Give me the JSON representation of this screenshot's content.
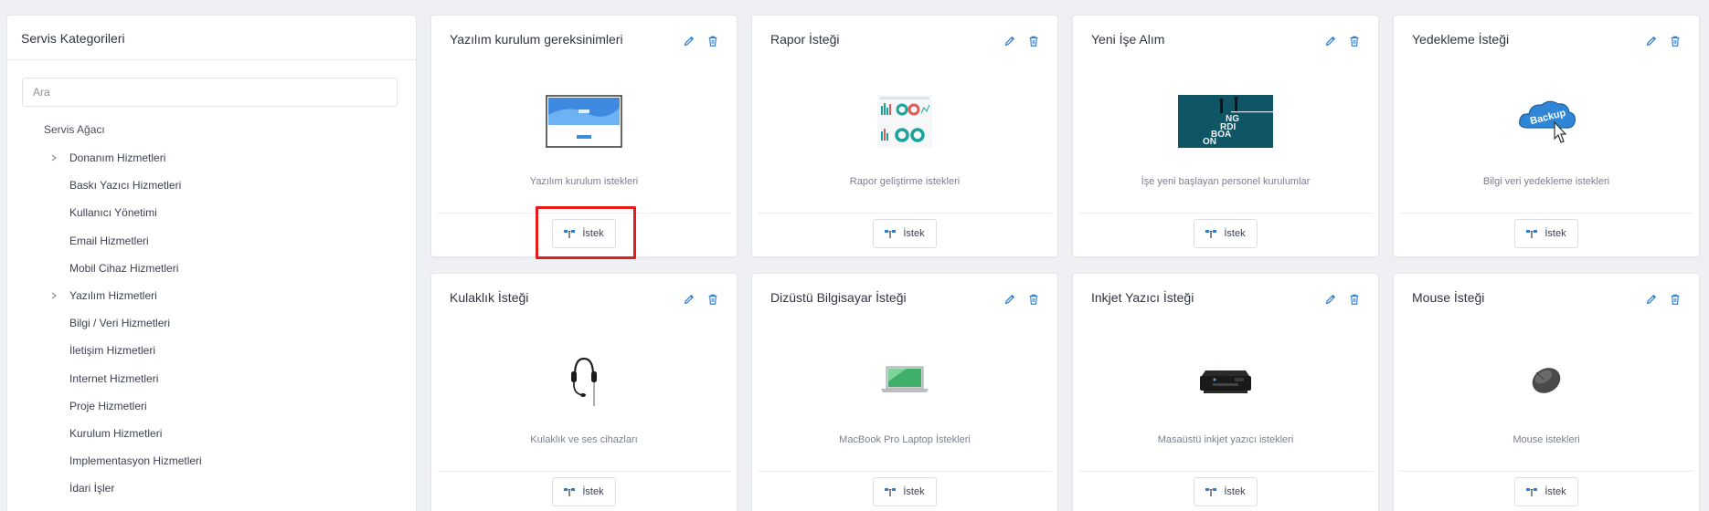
{
  "sidebar": {
    "title": "Servis Kategorileri",
    "search_placeholder": "Ara",
    "tree_root": "Servis Ağacı",
    "items": [
      {
        "label": "Donanım Hizmetleri",
        "expandable": true
      },
      {
        "label": "Baskı Yazıcı Hizmetleri",
        "expandable": false
      },
      {
        "label": "Kullanıcı Yönetimi",
        "expandable": false
      },
      {
        "label": "Email Hizmetleri",
        "expandable": false
      },
      {
        "label": "Mobil Cihaz Hizmetleri",
        "expandable": false
      },
      {
        "label": "Yazılım Hizmetleri",
        "expandable": true
      },
      {
        "label": "Bilgi / Veri Hizmetleri",
        "expandable": false
      },
      {
        "label": "İletişim Hizmetleri",
        "expandable": false
      },
      {
        "label": "Internet Hizmetleri",
        "expandable": false
      },
      {
        "label": "Proje Hizmetleri",
        "expandable": false
      },
      {
        "label": "Kurulum Hizmetleri",
        "expandable": false
      },
      {
        "label": "Implementasyon Hizmetleri",
        "expandable": false
      },
      {
        "label": "İdari İşler",
        "expandable": false
      }
    ]
  },
  "request_label": "İstek",
  "cards": [
    {
      "title": "Yazılım kurulum gereksinimleri",
      "description": "Yazılım kurulum istekleri",
      "image": "software-install-image"
    },
    {
      "title": "Rapor İsteği",
      "description": "Rapor geliştirme istekleri",
      "image": "report-dashboard-image"
    },
    {
      "title": "Yeni İşe Alım",
      "description": "İşe yeni başlayan personel kurulumlar",
      "image": "onboarding-image"
    },
    {
      "title": "Yedekleme İsteği",
      "description": "Bilgi veri yedekleme istekleri",
      "image": "backup-cloud-image"
    },
    {
      "title": "Kulaklık İsteği",
      "description": "Kulaklık ve ses cihazları",
      "image": "headset-image"
    },
    {
      "title": "Dizüstü Bilgisayar İsteği",
      "description": "MacBook Pro Laptop İstekleri",
      "image": "laptop-image"
    },
    {
      "title": "Inkjet Yazıcı İsteği",
      "description": "Masaüstü inkjet yazıcı istekleri",
      "image": "printer-image"
    },
    {
      "title": "Mouse İsteği",
      "description": "Mouse istekleri",
      "image": "mouse-image"
    }
  ],
  "onboarding_image_text": [
    "NG",
    "RDI",
    "BOA",
    "ON"
  ],
  "backup_image_text": "Backup",
  "colors": {
    "accent": "#2f7fd1",
    "highlight": "#e41c1c"
  }
}
